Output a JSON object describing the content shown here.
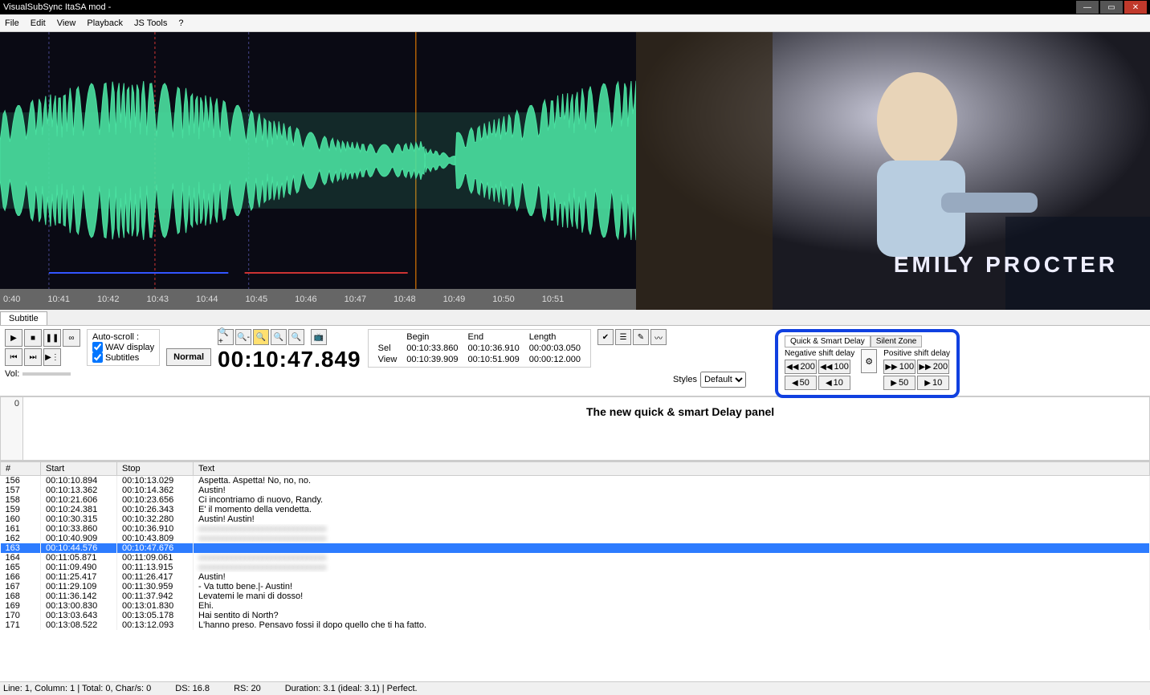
{
  "title": "VisualSubSync ItaSA mod -",
  "menu": [
    "File",
    "Edit",
    "View",
    "Playback",
    "JS Tools",
    "?"
  ],
  "timeline_ticks": [
    "0:40",
    "10:41",
    "10:42",
    "10:43",
    "10:44",
    "10:45",
    "10:46",
    "10:47",
    "10:48",
    "10:49",
    "10:50",
    "10:51"
  ],
  "video_overlay": "EMILY PROCTER",
  "tab_label": "Subtitle",
  "autoscroll": {
    "title": "Auto-scroll :",
    "wav": "WAV display",
    "subs": "Subtitles"
  },
  "vol_label": "Vol:",
  "normal_btn": "Normal",
  "big_time": "00:10:47.849",
  "timing": {
    "headers": [
      "",
      "Begin",
      "End",
      "Length"
    ],
    "sel_label": "Sel",
    "view_label": "View",
    "sel": [
      "00:10:33.860",
      "00:10:36.910",
      "00:00:03.050"
    ],
    "view": [
      "00:10:39.909",
      "00:10:51.909",
      "00:00:12.000"
    ]
  },
  "styles": {
    "label": "Styles",
    "value": "Default"
  },
  "delay": {
    "tab1": "Quick & Smart Delay",
    "tab2": "Silent Zone",
    "neg_title": "Negative shift delay",
    "pos_title": "Positive shift delay",
    "neg_vals": [
      "200",
      "100",
      "50",
      "10"
    ],
    "pos_vals": [
      "100",
      "200",
      "50",
      "10"
    ]
  },
  "callout": "The new quick & smart Delay panel",
  "editor_line": "0",
  "table_headers": [
    "#",
    "Start",
    "Stop",
    "Text"
  ],
  "rows": [
    {
      "n": "156",
      "s": "00:10:10.894",
      "e": "00:10:13.029",
      "t": "Aspetta. Aspetta! No, no, no.",
      "b": false
    },
    {
      "n": "157",
      "s": "00:10:13.362",
      "e": "00:10:14.362",
      "t": "Austin!",
      "b": false
    },
    {
      "n": "158",
      "s": "00:10:21.606",
      "e": "00:10:23.656",
      "t": "Ci incontriamo di nuovo, Randy.",
      "b": false
    },
    {
      "n": "159",
      "s": "00:10:24.381",
      "e": "00:10:26.343",
      "t": "E' il momento della vendetta.",
      "b": false
    },
    {
      "n": "160",
      "s": "00:10:30.315",
      "e": "00:10:32.280",
      "t": "Austin! Austin!",
      "b": false
    },
    {
      "n": "161",
      "s": "00:10:33.860",
      "e": "00:10:36.910",
      "t": "xxxxxxxxxxxxxxxxxxxxxxxxxxxxx",
      "b": true
    },
    {
      "n": "162",
      "s": "00:10:40.909",
      "e": "00:10:43.809",
      "t": "xxxxxxxxxxxxxxxxxxxxxxxxxxxxx",
      "b": true
    },
    {
      "n": "163",
      "s": "00:10:44.576",
      "e": "00:10:47.676",
      "t": "",
      "b": false,
      "sel": true
    },
    {
      "n": "164",
      "s": "00:11:05.871",
      "e": "00:11:09.061",
      "t": "xxxxxxxxxxxxxxxxxxxxxxxxxxxxx",
      "b": true
    },
    {
      "n": "165",
      "s": "00:11:09.490",
      "e": "00:11:13.915",
      "t": "xxxxxxxxxxxxxxxxxxxxxxxxxxxxx",
      "b": true
    },
    {
      "n": "166",
      "s": "00:11:25.417",
      "e": "00:11:26.417",
      "t": "Austin!",
      "b": false
    },
    {
      "n": "167",
      "s": "00:11:29.109",
      "e": "00:11:30.959",
      "t": "- Va tutto bene.|- Austin!",
      "b": false
    },
    {
      "n": "168",
      "s": "00:11:36.142",
      "e": "00:11:37.942",
      "t": "Levatemi le mani di dosso!",
      "b": false
    },
    {
      "n": "169",
      "s": "00:13:00.830",
      "e": "00:13:01.830",
      "t": "Ehi.",
      "b": false
    },
    {
      "n": "170",
      "s": "00:13:03.643",
      "e": "00:13:05.178",
      "t": "Hai sentito di North?",
      "b": false
    },
    {
      "n": "171",
      "s": "00:13:08.522",
      "e": "00:13:12.093",
      "t": "L'hanno preso. Pensavo fossi il dopo quello che ti ha fatto.",
      "b": false
    }
  ],
  "status": {
    "s1": "Line: 1, Column: 1 | Total: 0, Char/s: 0",
    "s2": "DS: 16.8",
    "s3": "RS: 20",
    "s4": "Duration: 3.1 (ideal: 3.1) |  Perfect."
  }
}
